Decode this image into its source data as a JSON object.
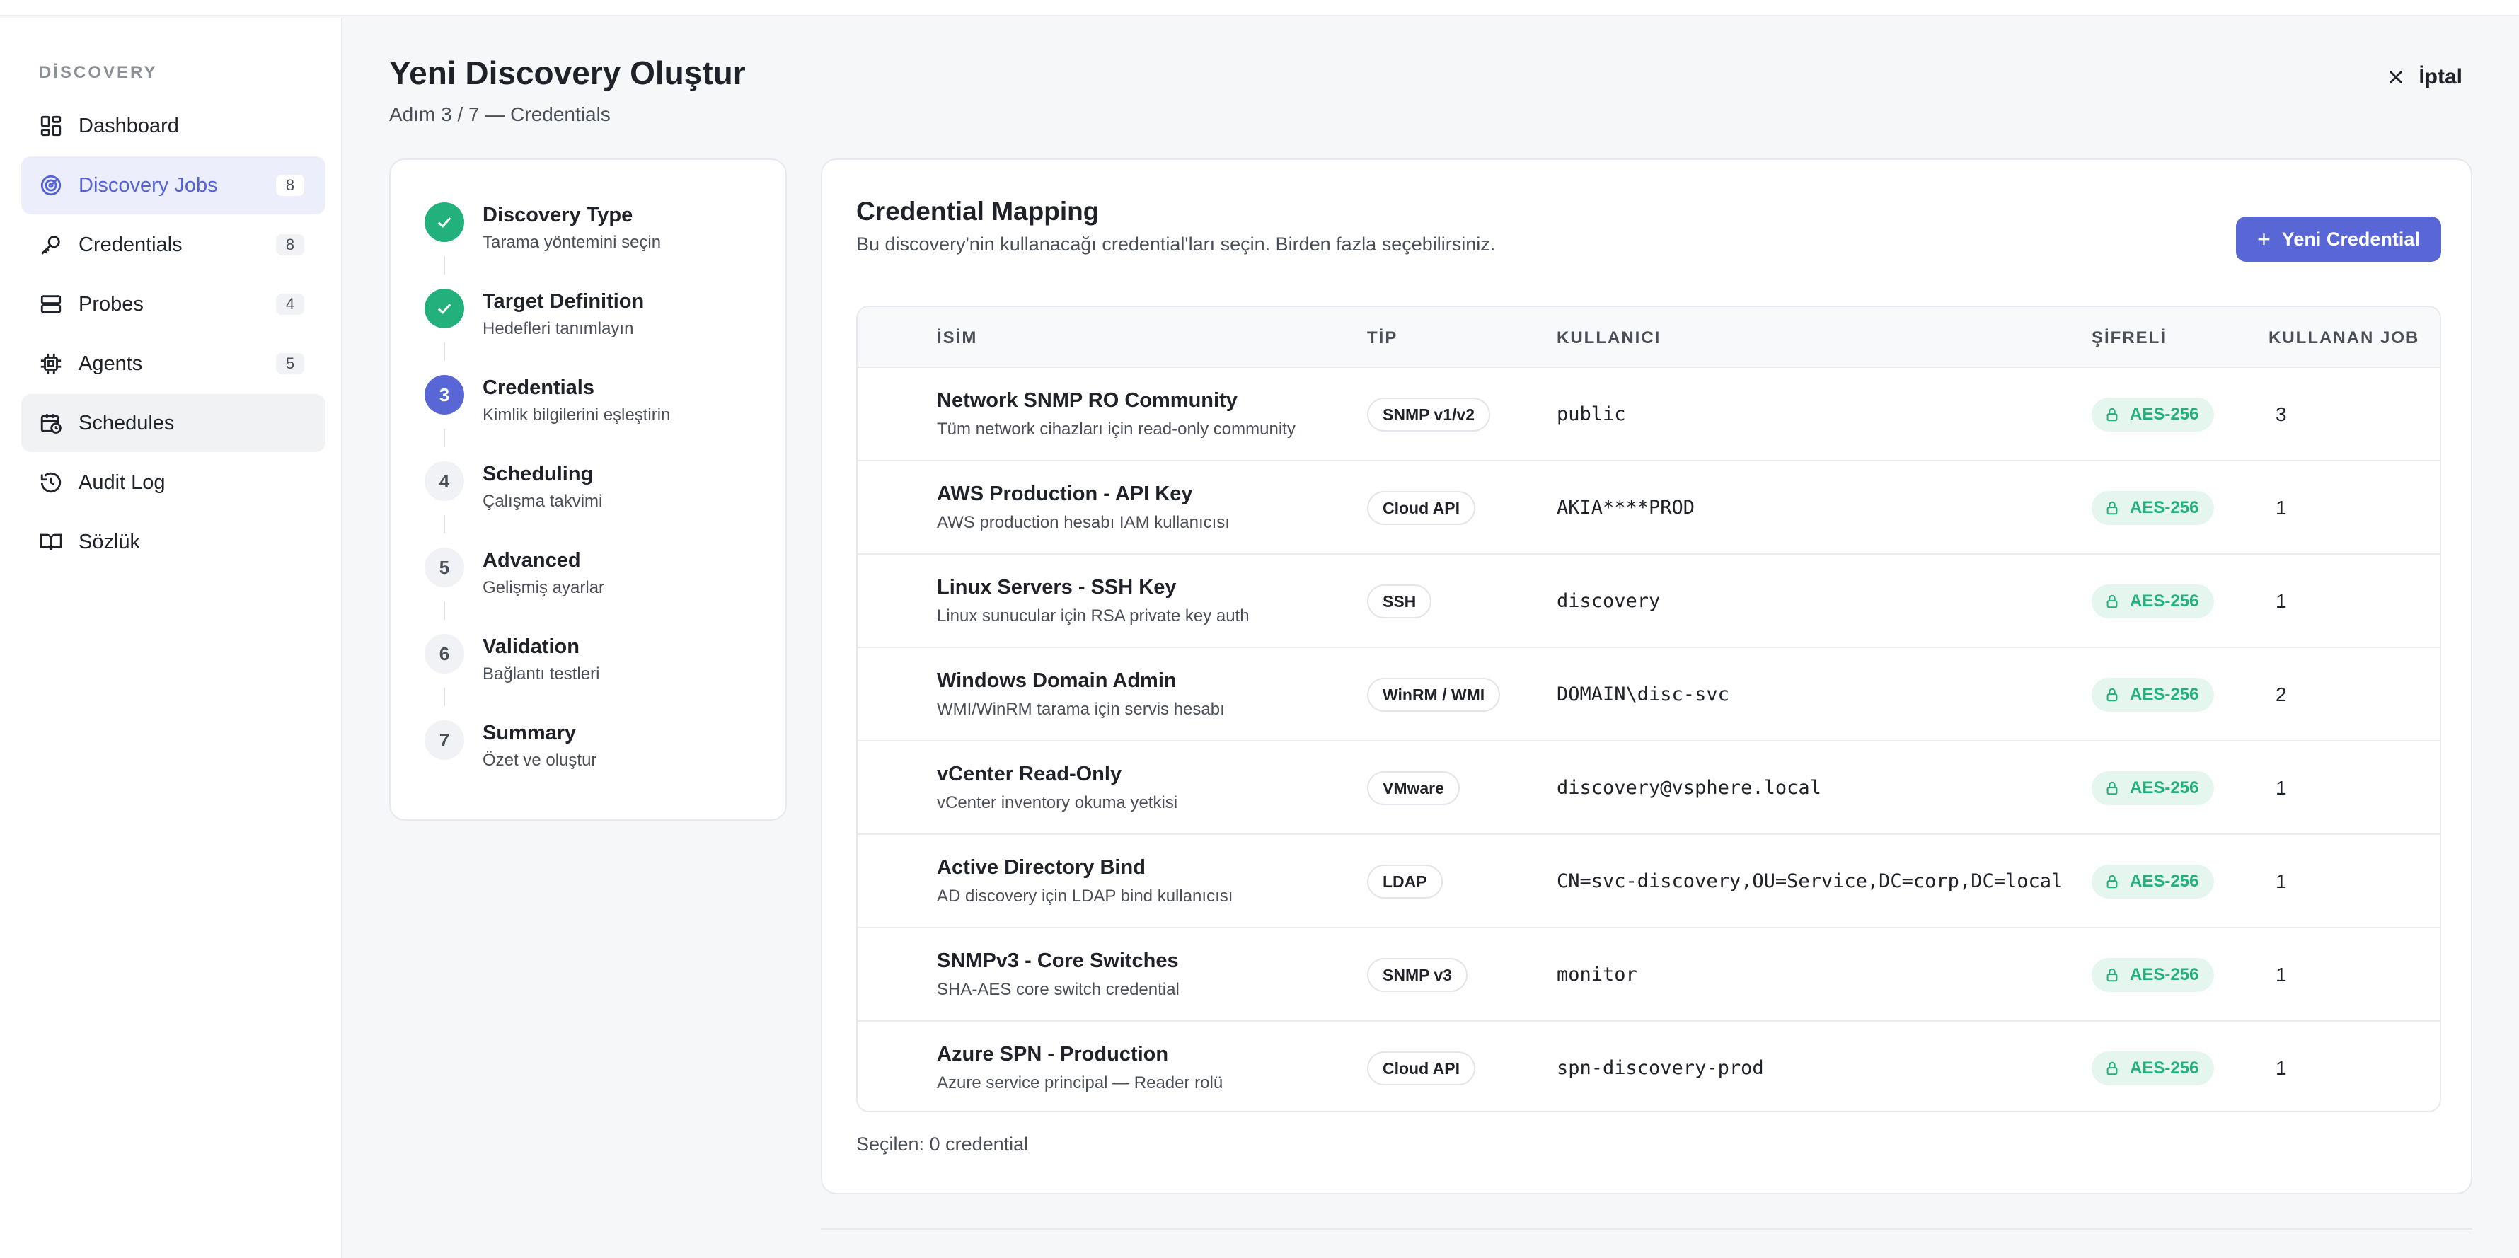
{
  "sidebar": {
    "section": "DİSCOVERY",
    "items": [
      {
        "label": "Dashboard",
        "icon": "dashboard-icon",
        "badge": ""
      },
      {
        "label": "Discovery Jobs",
        "icon": "radar-icon",
        "badge": "8"
      },
      {
        "label": "Credentials",
        "icon": "key-icon",
        "badge": "8"
      },
      {
        "label": "Probes",
        "icon": "server-icon",
        "badge": "4"
      },
      {
        "label": "Agents",
        "icon": "cpu-icon",
        "badge": "5"
      },
      {
        "label": "Schedules",
        "icon": "calendar-clock-icon",
        "badge": ""
      },
      {
        "label": "Audit Log",
        "icon": "history-icon",
        "badge": ""
      },
      {
        "label": "Sözlük",
        "icon": "book-icon",
        "badge": ""
      }
    ]
  },
  "header": {
    "title": "Yeni Discovery Oluştur",
    "subtitle": "Adım 3 / 7 — Credentials",
    "cancel_label": "İptal"
  },
  "steps": [
    {
      "number": "1",
      "title": "Discovery Type",
      "desc": "Tarama yöntemini seçin",
      "state": "done"
    },
    {
      "number": "2",
      "title": "Target Definition",
      "desc": "Hedefleri tanımlayın",
      "state": "done"
    },
    {
      "number": "3",
      "title": "Credentials",
      "desc": "Kimlik bilgilerini eşleştirin",
      "state": "current"
    },
    {
      "number": "4",
      "title": "Scheduling",
      "desc": "Çalışma takvimi",
      "state": "todo"
    },
    {
      "number": "5",
      "title": "Advanced",
      "desc": "Gelişmiş ayarlar",
      "state": "todo"
    },
    {
      "number": "6",
      "title": "Validation",
      "desc": "Bağlantı testleri",
      "state": "todo"
    },
    {
      "number": "7",
      "title": "Summary",
      "desc": "Özet ve oluştur",
      "state": "todo"
    }
  ],
  "mapping": {
    "title": "Credential Mapping",
    "subtitle": "Bu discovery'nin kullanacağı credential'ları seçin. Birden fazla seçebilirsiniz.",
    "new_button": "Yeni Credential",
    "columns": {
      "name": "İSİM",
      "type": "TİP",
      "user": "KULLANICI",
      "encrypted": "ŞİFRELİ",
      "jobs": "KULLANAN JOB"
    },
    "rows": [
      {
        "name": "Network SNMP RO Community",
        "desc": "Tüm network cihazları için read-only community",
        "type": "SNMP v1/v2",
        "user": "public",
        "enc": "AES-256",
        "jobs": "3"
      },
      {
        "name": "AWS Production - API Key",
        "desc": "AWS production hesabı IAM kullanıcısı",
        "type": "Cloud API",
        "user": "AKIA****PROD",
        "enc": "AES-256",
        "jobs": "1"
      },
      {
        "name": "Linux Servers - SSH Key",
        "desc": "Linux sunucular için RSA private key auth",
        "type": "SSH",
        "user": "discovery",
        "enc": "AES-256",
        "jobs": "1"
      },
      {
        "name": "Windows Domain Admin",
        "desc": "WMI/WinRM tarama için servis hesabı",
        "type": "WinRM / WMI",
        "user": "DOMAIN\\disc-svc",
        "enc": "AES-256",
        "jobs": "2"
      },
      {
        "name": "vCenter Read-Only",
        "desc": "vCenter inventory okuma yetkisi",
        "type": "VMware",
        "user": "discovery@vsphere.local",
        "enc": "AES-256",
        "jobs": "1"
      },
      {
        "name": "Active Directory Bind",
        "desc": "AD discovery için LDAP bind kullanıcısı",
        "type": "LDAP",
        "user": "CN=svc-discovery,OU=Service,DC=corp,DC=local",
        "enc": "AES-256",
        "jobs": "1"
      },
      {
        "name": "SNMPv3 - Core Switches",
        "desc": "SHA-AES core switch credential",
        "type": "SNMP v3",
        "user": "monitor",
        "enc": "AES-256",
        "jobs": "1"
      },
      {
        "name": "Azure SPN - Production",
        "desc": "Azure service principal — Reader rolü",
        "type": "Cloud API",
        "user": "spn-discovery-prod",
        "enc": "AES-256",
        "jobs": "1"
      }
    ],
    "selected_note": "Seçilen: 0 credential"
  },
  "colors": {
    "accent": "#5966d6",
    "success": "#22b07d"
  }
}
